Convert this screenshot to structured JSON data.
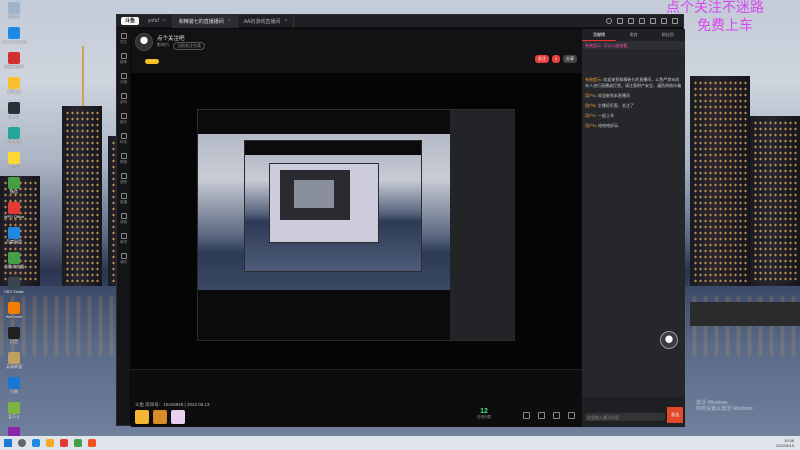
{
  "watermark": {
    "line1": "点个关注不迷路",
    "line2": "免费上车"
  },
  "desktop_icons": [
    {
      "label": "回收站",
      "color": "#9fb4cc"
    },
    {
      "label": "Microsoft Edge",
      "color": "#1e88e5"
    },
    {
      "label": "网易云音乐",
      "color": "#d32f2f"
    },
    {
      "label": "腾讯QQ",
      "color": "#fbc02d"
    },
    {
      "label": "Steam",
      "color": "#263238"
    },
    {
      "label": "哔哩哔哩",
      "color": "#26a69a"
    },
    {
      "label": "QQ音乐",
      "color": "#fdd835"
    },
    {
      "label": "微信",
      "color": "#43a047"
    },
    {
      "label": "WPS Office",
      "color": "#e53935"
    },
    {
      "label": "百度网盘",
      "color": "#1e88e5"
    },
    {
      "label": "谷歌浏览器",
      "color": "#43a047"
    },
    {
      "label": "OBS Studio",
      "color": "#37474f"
    },
    {
      "label": "WeGame",
      "color": "#f57c00"
    },
    {
      "label": "抖音",
      "color": "#212121"
    },
    {
      "label": "英雄联盟",
      "color": "#c0a060"
    },
    {
      "label": "迅雷",
      "color": "#1976d2"
    },
    {
      "label": "爱奇艺",
      "color": "#7cb342"
    },
    {
      "label": "UU加速器",
      "color": "#8e24aa"
    }
  ],
  "window": {
    "logo": "斗鱼",
    "tabs": [
      {
        "label": "yofuf",
        "active": false
      },
      {
        "label": "和精装七的直播播间",
        "active": true
      },
      {
        "label": "AA的游戏直播间",
        "active": false
      }
    ]
  },
  "nav": [
    "关注",
    "推荐",
    "分类",
    "游戏",
    "娱乐",
    "科技",
    "赛事",
    "音频",
    "直播",
    "商城",
    "鱼吧",
    "我的"
  ],
  "room": {
    "title": "点个关注吧",
    "meta1": "影响力",
    "meta2": "当前关注分类",
    "btn_follow": "关注",
    "btn_count": "1",
    "btn_share": "分享"
  },
  "bottom": {
    "uid_text": "斗鱼 房间号：10416945 | 2022.06.13",
    "online_count": "12",
    "online_label": "在线列表"
  },
  "chat": {
    "tabs": [
      "贡献榜",
      "贵宾",
      "粉丝团"
    ],
    "notice": "系统提示: 可以入座观看",
    "messages": [
      {
        "name": "系统提示",
        "text": "欢迎来到和精装七的直播间，斗鱼严禁未成年人进行直播或打赏，请注意财产安全，谨防网络诈骗"
      },
      {
        "name": "用户A",
        "text": "欢迎来到本直播间"
      },
      {
        "name": "用户B",
        "text": "主播好厉害，关注了"
      },
      {
        "name": "用户C",
        "text": "一起上车"
      },
      {
        "name": "用户D",
        "text": "哈哈哈好玩"
      }
    ],
    "input_placeholder": "这里输入聊天内容",
    "send_label": "发送"
  },
  "taskbar": {
    "time": "19:36",
    "date": "2022/6/13"
  },
  "activate_text": {
    "line1": "激活 Windows",
    "line2": "转到设置以激活 Windows"
  }
}
